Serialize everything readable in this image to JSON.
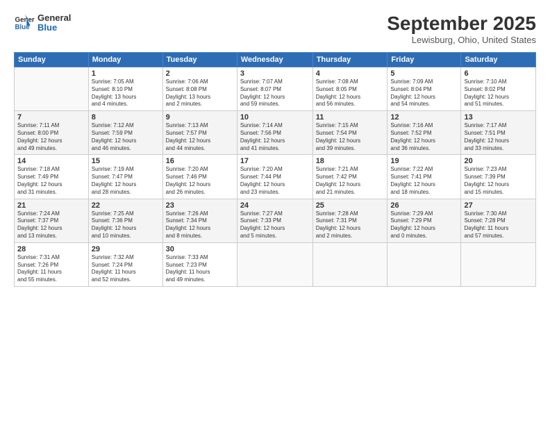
{
  "header": {
    "logo_line1": "General",
    "logo_line2": "Blue",
    "month": "September 2025",
    "location": "Lewisburg, Ohio, United States"
  },
  "weekdays": [
    "Sunday",
    "Monday",
    "Tuesday",
    "Wednesday",
    "Thursday",
    "Friday",
    "Saturday"
  ],
  "weeks": [
    [
      {
        "day": "",
        "info": ""
      },
      {
        "day": "1",
        "info": "Sunrise: 7:05 AM\nSunset: 8:10 PM\nDaylight: 13 hours\nand 4 minutes."
      },
      {
        "day": "2",
        "info": "Sunrise: 7:06 AM\nSunset: 8:08 PM\nDaylight: 13 hours\nand 2 minutes."
      },
      {
        "day": "3",
        "info": "Sunrise: 7:07 AM\nSunset: 8:07 PM\nDaylight: 12 hours\nand 59 minutes."
      },
      {
        "day": "4",
        "info": "Sunrise: 7:08 AM\nSunset: 8:05 PM\nDaylight: 12 hours\nand 56 minutes."
      },
      {
        "day": "5",
        "info": "Sunrise: 7:09 AM\nSunset: 8:04 PM\nDaylight: 12 hours\nand 54 minutes."
      },
      {
        "day": "6",
        "info": "Sunrise: 7:10 AM\nSunset: 8:02 PM\nDaylight: 12 hours\nand 51 minutes."
      }
    ],
    [
      {
        "day": "7",
        "info": "Sunrise: 7:11 AM\nSunset: 8:00 PM\nDaylight: 12 hours\nand 49 minutes."
      },
      {
        "day": "8",
        "info": "Sunrise: 7:12 AM\nSunset: 7:59 PM\nDaylight: 12 hours\nand 46 minutes."
      },
      {
        "day": "9",
        "info": "Sunrise: 7:13 AM\nSunset: 7:57 PM\nDaylight: 12 hours\nand 44 minutes."
      },
      {
        "day": "10",
        "info": "Sunrise: 7:14 AM\nSunset: 7:56 PM\nDaylight: 12 hours\nand 41 minutes."
      },
      {
        "day": "11",
        "info": "Sunrise: 7:15 AM\nSunset: 7:54 PM\nDaylight: 12 hours\nand 39 minutes."
      },
      {
        "day": "12",
        "info": "Sunrise: 7:16 AM\nSunset: 7:52 PM\nDaylight: 12 hours\nand 36 minutes."
      },
      {
        "day": "13",
        "info": "Sunrise: 7:17 AM\nSunset: 7:51 PM\nDaylight: 12 hours\nand 33 minutes."
      }
    ],
    [
      {
        "day": "14",
        "info": "Sunrise: 7:18 AM\nSunset: 7:49 PM\nDaylight: 12 hours\nand 31 minutes."
      },
      {
        "day": "15",
        "info": "Sunrise: 7:19 AM\nSunset: 7:47 PM\nDaylight: 12 hours\nand 28 minutes."
      },
      {
        "day": "16",
        "info": "Sunrise: 7:20 AM\nSunset: 7:46 PM\nDaylight: 12 hours\nand 26 minutes."
      },
      {
        "day": "17",
        "info": "Sunrise: 7:20 AM\nSunset: 7:44 PM\nDaylight: 12 hours\nand 23 minutes."
      },
      {
        "day": "18",
        "info": "Sunrise: 7:21 AM\nSunset: 7:42 PM\nDaylight: 12 hours\nand 21 minutes."
      },
      {
        "day": "19",
        "info": "Sunrise: 7:22 AM\nSunset: 7:41 PM\nDaylight: 12 hours\nand 18 minutes."
      },
      {
        "day": "20",
        "info": "Sunrise: 7:23 AM\nSunset: 7:39 PM\nDaylight: 12 hours\nand 15 minutes."
      }
    ],
    [
      {
        "day": "21",
        "info": "Sunrise: 7:24 AM\nSunset: 7:37 PM\nDaylight: 12 hours\nand 13 minutes."
      },
      {
        "day": "22",
        "info": "Sunrise: 7:25 AM\nSunset: 7:36 PM\nDaylight: 12 hours\nand 10 minutes."
      },
      {
        "day": "23",
        "info": "Sunrise: 7:26 AM\nSunset: 7:34 PM\nDaylight: 12 hours\nand 8 minutes."
      },
      {
        "day": "24",
        "info": "Sunrise: 7:27 AM\nSunset: 7:33 PM\nDaylight: 12 hours\nand 5 minutes."
      },
      {
        "day": "25",
        "info": "Sunrise: 7:28 AM\nSunset: 7:31 PM\nDaylight: 12 hours\nand 2 minutes."
      },
      {
        "day": "26",
        "info": "Sunrise: 7:29 AM\nSunset: 7:29 PM\nDaylight: 12 hours\nand 0 minutes."
      },
      {
        "day": "27",
        "info": "Sunrise: 7:30 AM\nSunset: 7:28 PM\nDaylight: 11 hours\nand 57 minutes."
      }
    ],
    [
      {
        "day": "28",
        "info": "Sunrise: 7:31 AM\nSunset: 7:26 PM\nDaylight: 11 hours\nand 55 minutes."
      },
      {
        "day": "29",
        "info": "Sunrise: 7:32 AM\nSunset: 7:24 PM\nDaylight: 11 hours\nand 52 minutes."
      },
      {
        "day": "30",
        "info": "Sunrise: 7:33 AM\nSunset: 7:23 PM\nDaylight: 11 hours\nand 49 minutes."
      },
      {
        "day": "",
        "info": ""
      },
      {
        "day": "",
        "info": ""
      },
      {
        "day": "",
        "info": ""
      },
      {
        "day": "",
        "info": ""
      }
    ]
  ]
}
